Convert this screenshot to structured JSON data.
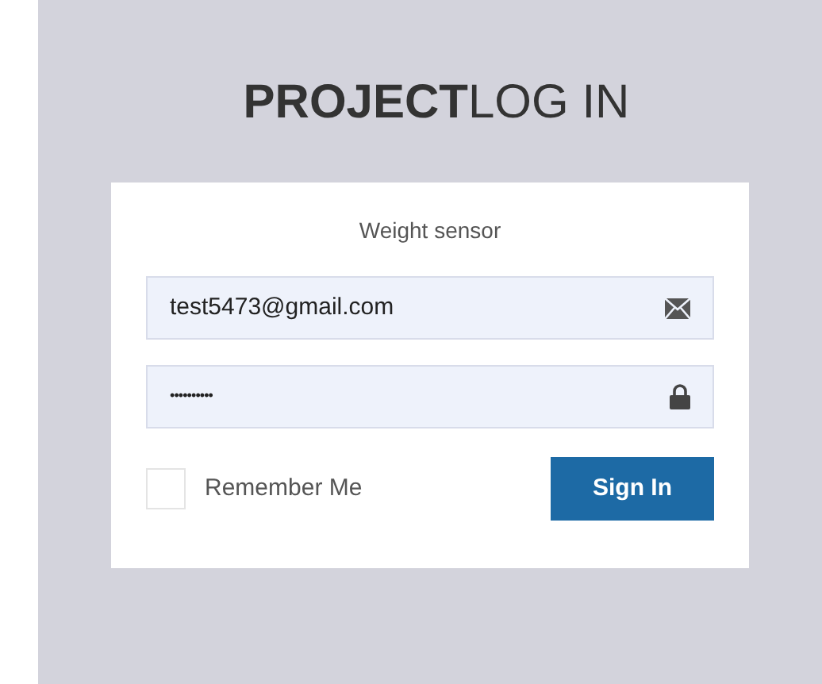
{
  "title": "**PROJECT**LOG IN",
  "card": {
    "subtitle": "Weight sensor",
    "fields": [
      {
        "kind": "email",
        "value": "test5473@gmail.com"
      },
      {
        "kind": "password",
        "value": "••••••••••"
      }
    ],
    "remember": {
      "label": "Remember Me",
      "checked": false
    },
    "button": "Sign In"
  }
}
